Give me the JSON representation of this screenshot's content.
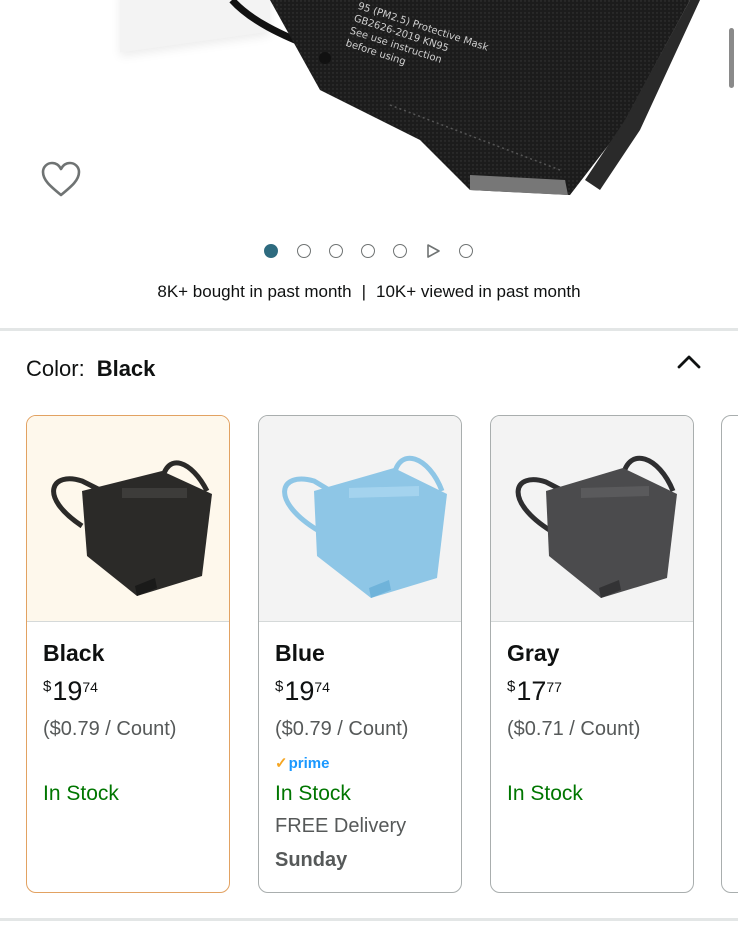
{
  "hero": {
    "mask_print": [
      "95 (PM2.5) Protective Mask",
      "GB2626-2019 KN95",
      "See use instruction",
      "before using"
    ],
    "carousel": {
      "count": 7,
      "active_index": 0,
      "video_index": 5
    },
    "stats": {
      "bought": "8K+ bought in past month",
      "separator": "|",
      "viewed": "10K+ viewed in past month"
    }
  },
  "color_selector": {
    "label": "Color:",
    "selected": "Black",
    "options": [
      {
        "name": "Black",
        "currency": "$",
        "whole": "19",
        "fraction": "74",
        "unit_price": "($0.79 / Count)",
        "prime": "",
        "stock": "In Stock",
        "delivery": "",
        "delivery_day": "",
        "mask_color": "#2b2a28"
      },
      {
        "name": "Blue",
        "currency": "$",
        "whole": "19",
        "fraction": "74",
        "unit_price": "($0.79 / Count)",
        "prime": "prime",
        "stock": "In Stock",
        "delivery": "FREE Delivery",
        "delivery_day": "Sunday",
        "mask_color": "#8ec6e6"
      },
      {
        "name": "Gray",
        "currency": "$",
        "whole": "17",
        "fraction": "77",
        "unit_price": "($0.71 / Count)",
        "prime": "",
        "stock": "In Stock",
        "delivery": "",
        "delivery_day": "",
        "mask_color": "#4b4b4d"
      }
    ]
  },
  "colors": {
    "accent": "#2e6b7f",
    "in_stock": "#007600",
    "prime": "#1a98ff",
    "selected_border": "#e2a262"
  }
}
